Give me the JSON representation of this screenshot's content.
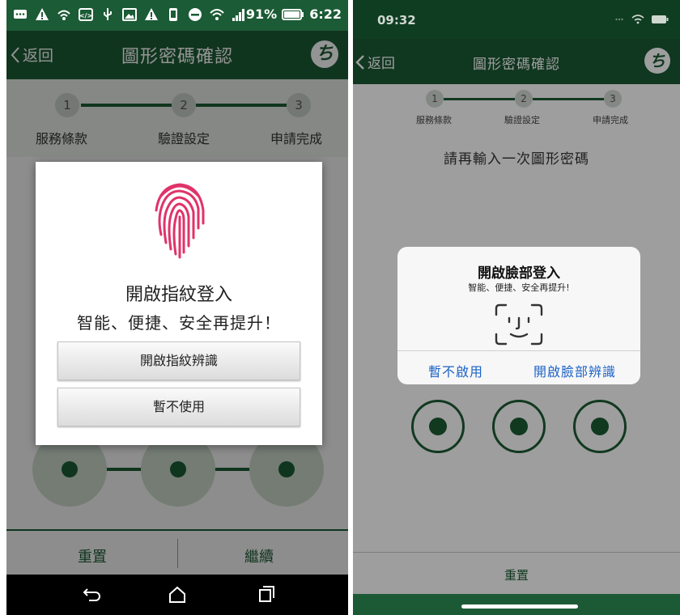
{
  "left": {
    "status": {
      "battery": "91%",
      "time": "6:22"
    },
    "nav": {
      "back": "返回",
      "title": "圖形密碼確認"
    },
    "steps": [
      {
        "num": "1",
        "label": "服務條款"
      },
      {
        "num": "2",
        "label": "驗證設定"
      },
      {
        "num": "3",
        "label": "申請完成"
      }
    ],
    "dialog": {
      "title": "開啟指紋登入",
      "subtitle": "智能、便捷、安全再提升！",
      "primary": "開啟指紋辨識",
      "secondary": "暫不使用"
    },
    "bottom": {
      "reset": "重置",
      "continue": "繼續"
    }
  },
  "right": {
    "status": {
      "time": "09:32"
    },
    "nav": {
      "back": "返回",
      "title": "圖形密碼確認"
    },
    "steps": [
      {
        "num": "1",
        "label": "服務條款"
      },
      {
        "num": "2",
        "label": "驗證設定"
      },
      {
        "num": "3",
        "label": "申請完成"
      }
    ],
    "prompt": "請再輸入一次圖形密碼",
    "dialog": {
      "title": "開啟臉部登入",
      "subtitle": "智能、便捷、安全再提升!",
      "cancel": "暫不啟用",
      "confirm": "開啟臉部辨識"
    },
    "bottom": {
      "reset": "重置"
    }
  },
  "colors": {
    "brand_green": "#1c5c35",
    "ios_link": "#1d63c7",
    "fingerprint_pink": "#e0336a"
  },
  "icons": [
    "fingerprint-icon",
    "face-id-icon",
    "back-chevron-icon",
    "logo-icon",
    "android-back-icon",
    "android-home-icon",
    "android-recents-icon"
  ]
}
